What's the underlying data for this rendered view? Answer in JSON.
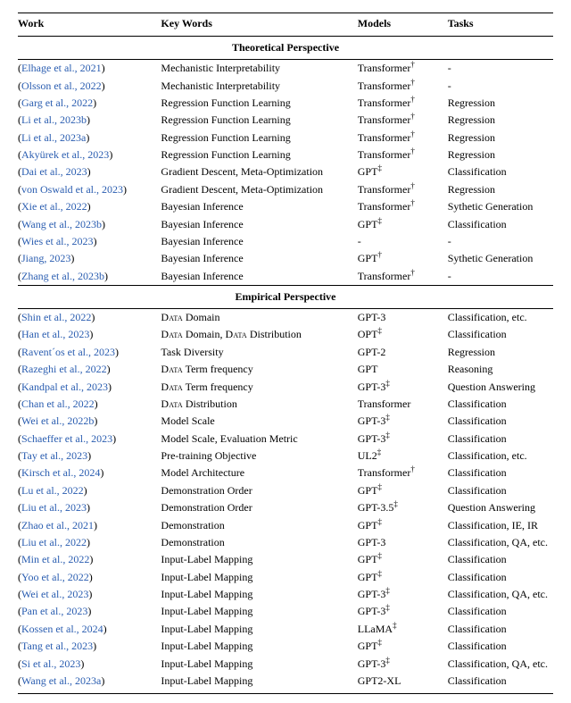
{
  "headers": {
    "work": "Work",
    "keywords": "Key Words",
    "models": "Models",
    "tasks": "Tasks"
  },
  "sections": [
    {
      "title": "Theoretical Perspective",
      "rows": [
        {
          "cite": "Elhage et al., 2021",
          "keywords": "Mechanistic Interpretability",
          "model": "Transformer",
          "sup": "†",
          "tasks": "-"
        },
        {
          "cite": "Olsson et al., 2022",
          "keywords": "Mechanistic Interpretability",
          "model": "Transformer",
          "sup": "†",
          "tasks": "-"
        },
        {
          "cite": "Garg et al., 2022",
          "keywords": "Regression Function Learning",
          "model": "Transformer",
          "sup": "†",
          "tasks": "Regression"
        },
        {
          "cite": "Li et al., 2023b",
          "keywords": "Regression Function Learning",
          "model": "Transformer",
          "sup": "†",
          "tasks": "Regression"
        },
        {
          "cite": "Li et al., 2023a",
          "keywords": "Regression Function Learning",
          "model": "Transformer",
          "sup": "†",
          "tasks": "Regression"
        },
        {
          "cite": "Akyürek et al., 2023",
          "keywords": "Regression Function Learning",
          "model": "Transformer",
          "sup": "†",
          "tasks": "Regression"
        },
        {
          "cite": "Dai et al., 2023",
          "keywords": "Gradient Descent, Meta-Optimization",
          "model": "GPT",
          "sup": "‡",
          "tasks": "Classification"
        },
        {
          "cite": "von Oswald et al., 2023",
          "keywords": "Gradient Descent, Meta-Optimization",
          "model": "Transformer",
          "sup": "†",
          "tasks": "Regression"
        },
        {
          "cite": "Xie et al., 2022",
          "keywords": "Bayesian Inference",
          "model": "Transformer",
          "sup": "†",
          "tasks": "Sythetic Generation"
        },
        {
          "cite": "Wang et al., 2023b",
          "keywords": "Bayesian Inference",
          "model": "GPT",
          "sup": "‡",
          "tasks": "Classification"
        },
        {
          "cite": "Wies et al., 2023",
          "keywords": "Bayesian Inference",
          "model": "-",
          "sup": "",
          "tasks": "-"
        },
        {
          "cite": "Jiang, 2023",
          "keywords": "Bayesian Inference",
          "model": "GPT",
          "sup": "†",
          "tasks": "Sythetic Generation"
        },
        {
          "cite": "Zhang et al., 2023b",
          "keywords": "Bayesian Inference",
          "model": "Transformer",
          "sup": "†",
          "tasks": "-"
        }
      ]
    },
    {
      "title": "Empirical Perspective",
      "rows": [
        {
          "cite": "Shin et al., 2022",
          "keywords_sc": [
            "Data"
          ],
          "keywords_rest": " Domain",
          "model": "GPT-3",
          "sup": "",
          "tasks": "Classification, etc."
        },
        {
          "cite": "Han et al., 2023",
          "keywords_sc": [
            "Data",
            "Data"
          ],
          "keywords_pattern": "{0} Domain, {1} Distribution",
          "model": "OPT",
          "sup": "‡",
          "tasks": "Classification"
        },
        {
          "cite": "Ravent´os et al., 2023",
          "keywords": "Task Diversity",
          "model": "GPT-2",
          "sup": "",
          "tasks": "Regression"
        },
        {
          "cite": "Razeghi et al., 2022",
          "keywords_sc": [
            "Data"
          ],
          "keywords_rest": " Term frequency",
          "model": "GPT",
          "sup": "",
          "tasks": "Reasoning"
        },
        {
          "cite": "Kandpal et al., 2023",
          "keywords_sc": [
            "Data"
          ],
          "keywords_rest": " Term frequency",
          "model": "GPT-3",
          "sup": "‡",
          "tasks": "Question Answering"
        },
        {
          "cite": "Chan et al., 2022",
          "keywords_sc": [
            "Data"
          ],
          "keywords_rest": " Distribution",
          "model": "Transformer",
          "sup": "",
          "tasks": "Classification"
        },
        {
          "cite": "Wei et al., 2022b",
          "keywords": "Model Scale",
          "model": "GPT-3",
          "sup": "‡",
          "tasks": "Classification"
        },
        {
          "cite": "Schaeffer et al., 2023",
          "keywords": "Model Scale, Evaluation Metric",
          "model": "GPT-3",
          "sup": "‡",
          "tasks": "Classification"
        },
        {
          "cite": "Tay et al., 2023",
          "keywords": "Pre-training Objective",
          "model": "UL2",
          "sup": "‡",
          "tasks": "Classification, etc."
        },
        {
          "cite": "Kirsch et al., 2024",
          "keywords": "Model Architecture",
          "model": "Transformer",
          "sup": "†",
          "tasks": "Classification"
        },
        {
          "cite": "Lu et al., 2022",
          "keywords": "Demonstration Order",
          "model": "GPT",
          "sup": "‡",
          "tasks": "Classification"
        },
        {
          "cite": "Liu et al., 2023",
          "keywords": "Demonstration Order",
          "model": "GPT-3.5",
          "sup": "‡",
          "tasks": "Question Answering"
        },
        {
          "cite": "Zhao et al., 2021",
          "keywords": "Demonstration",
          "model": "GPT",
          "sup": "‡",
          "tasks": "Classification, IE, IR"
        },
        {
          "cite": "Liu et al., 2022",
          "keywords": "Demonstration",
          "model": "GPT-3",
          "sup": "",
          "tasks": "Classification, QA, etc."
        },
        {
          "cite": "Min et al., 2022",
          "keywords": "Input-Label Mapping",
          "model": "GPT",
          "sup": "‡",
          "tasks": "Classification"
        },
        {
          "cite": "Yoo et al., 2022",
          "keywords": "Input-Label Mapping",
          "model": "GPT",
          "sup": "‡",
          "tasks": "Classification"
        },
        {
          "cite": "Wei et al., 2023",
          "keywords": "Input-Label Mapping",
          "model": "GPT-3",
          "sup": "‡",
          "tasks": "Classification, QA, etc."
        },
        {
          "cite": "Pan et al., 2023",
          "keywords": "Input-Label Mapping",
          "model": "GPT-3",
          "sup": "‡",
          "tasks": "Classification"
        },
        {
          "cite": "Kossen et al., 2024",
          "keywords": "Input-Label Mapping",
          "model": "LLaMA",
          "sup": "‡",
          "tasks": "Classification"
        },
        {
          "cite": "Tang et al., 2023",
          "keywords": "Input-Label Mapping",
          "model": "GPT",
          "sup": "‡",
          "tasks": "Classification"
        },
        {
          "cite": "Si et al., 2023",
          "keywords": "Input-Label Mapping",
          "model": "GPT-3",
          "sup": "‡",
          "tasks": "Classification, QA, etc."
        },
        {
          "cite": "Wang et al., 2023a",
          "keywords": "Input-Label Mapping",
          "model": "GPT2-XL",
          "sup": "",
          "tasks": "Classification"
        }
      ]
    }
  ]
}
